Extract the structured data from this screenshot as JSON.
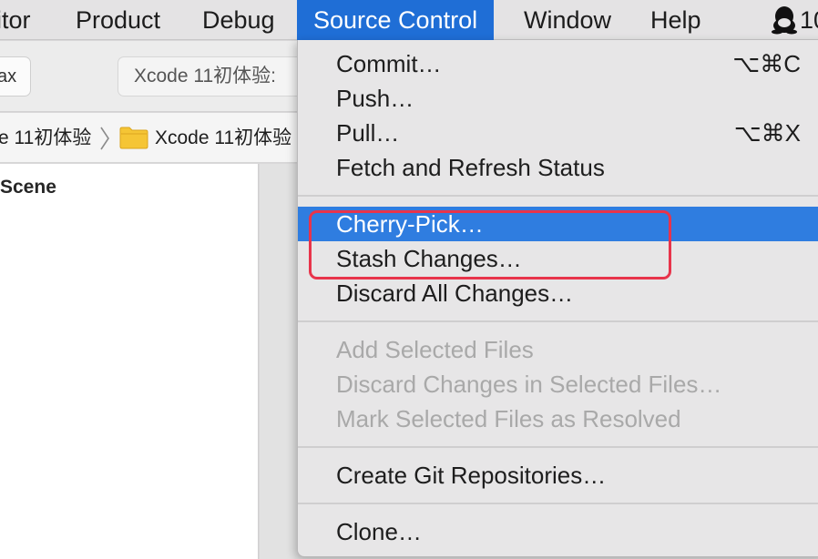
{
  "menubar": {
    "items": [
      {
        "label": "itor"
      },
      {
        "label": "Product"
      },
      {
        "label": "Debug"
      },
      {
        "label": "Source Control",
        "active": true
      },
      {
        "label": "Window"
      },
      {
        "label": "Help"
      }
    ],
    "status_icon": "qq-penguin-icon",
    "status_text": "10"
  },
  "toolbar": {
    "left_button_label": "ax",
    "scheme_label": "Xcode 11初体验:"
  },
  "jumpbar": {
    "crumb_1": "e 11初体验",
    "crumb_2": "Xcode 11初体验"
  },
  "navigator": {
    "scene_label": "Scene"
  },
  "menu": {
    "commit": {
      "label": "Commit…",
      "shortcut": "⌥⌘C"
    },
    "push": {
      "label": "Push…"
    },
    "pull": {
      "label": "Pull…",
      "shortcut": "⌥⌘X"
    },
    "fetch": {
      "label": "Fetch and Refresh Status"
    },
    "cherry_pick": {
      "label": "Cherry-Pick…"
    },
    "stash": {
      "label": "Stash Changes…"
    },
    "discard_all": {
      "label": "Discard All Changes…"
    },
    "add_selected": {
      "label": "Add Selected Files"
    },
    "discard_selected": {
      "label": "Discard Changes in Selected Files…"
    },
    "mark_resolved": {
      "label": "Mark Selected Files as Resolved"
    },
    "create_repo": {
      "label": "Create Git Repositories…"
    },
    "clone": {
      "label": "Clone…"
    }
  },
  "colors": {
    "menu_highlight": "#2f7de0",
    "menubar_active": "#1f6ed6",
    "annotation": "#e8344b"
  }
}
